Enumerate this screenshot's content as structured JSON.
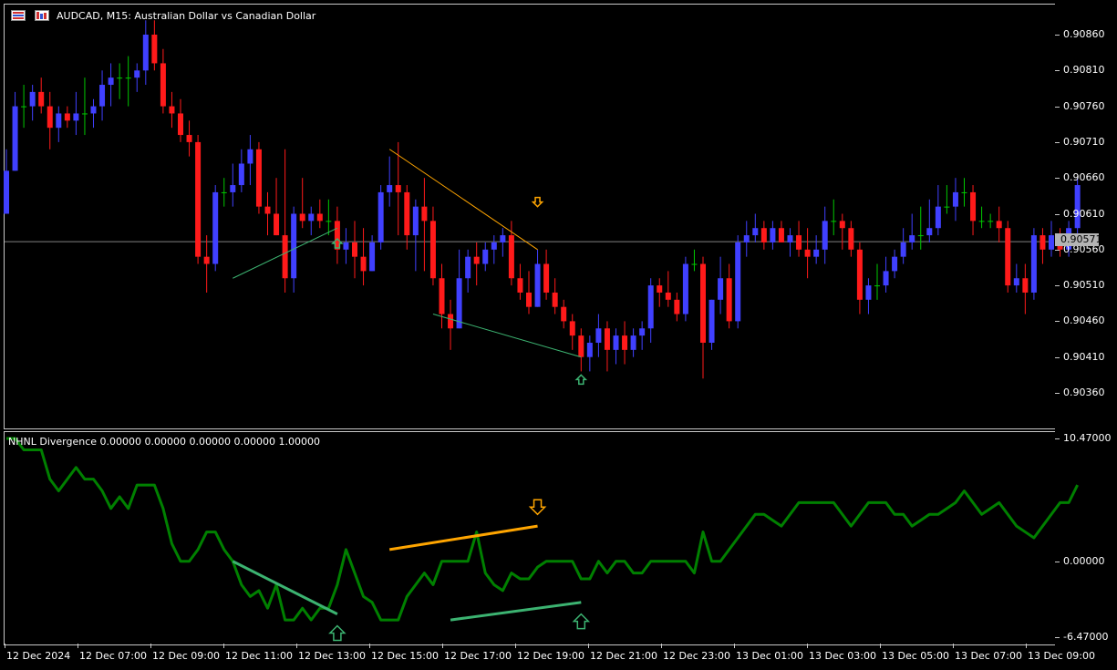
{
  "chart": {
    "symbol_title": "AUDCAD, M15:  Australian Dollar vs Canadian Dollar",
    "current_price": "0.90571",
    "price_labels": [
      "0.90860",
      "0.90810",
      "0.90760",
      "0.90710",
      "0.90660",
      "0.90610",
      "0.90560",
      "0.90510",
      "0.90460",
      "0.90410",
      "0.90360"
    ]
  },
  "indicator": {
    "title": "NHNL Divergence 0.00000 0.00000 0.00000 0.00000 1.00000",
    "labels": [
      "10.47000",
      "0.00000",
      "-6.47000"
    ]
  },
  "time_axis": {
    "labels": [
      "12 Dec 2024",
      "12 Dec 07:00",
      "12 Dec 09:00",
      "12 Dec 11:00",
      "12 Dec 13:00",
      "12 Dec 15:00",
      "12 Dec 17:00",
      "12 Dec 19:00",
      "12 Dec 21:00",
      "12 Dec 23:00",
      "13 Dec 01:00",
      "13 Dec 03:00",
      "13 Dec 05:00",
      "13 Dec 07:00",
      "13 Dec 09:00"
    ]
  },
  "colors": {
    "bull_candle": "#4040ff",
    "bear_candle": "#ff1a1a",
    "doji_candle": "#00c800",
    "indicator_line": "#008000",
    "bearish_divergence": "#ffa500",
    "bullish_divergence": "#3cb371",
    "bid_line": "#808080"
  },
  "chart_data": {
    "type": "candlestick",
    "price_range": [
      0.9032,
      0.9089
    ],
    "indicator_range": [
      -6.47,
      10.47
    ],
    "candles": [
      [
        0.9061,
        0.907,
        0.9062,
        0.9067
      ],
      [
        0.9067,
        0.9078,
        0.9067,
        0.9076
      ],
      [
        0.9076,
        0.9079,
        0.9073,
        0.9076
      ],
      [
        0.9076,
        0.9079,
        0.9074,
        0.9078
      ],
      [
        0.9078,
        0.908,
        0.9075,
        0.9076
      ],
      [
        0.9076,
        0.9078,
        0.907,
        0.9073
      ],
      [
        0.9073,
        0.9076,
        0.9071,
        0.9075
      ],
      [
        0.9075,
        0.9076,
        0.9073,
        0.9074
      ],
      [
        0.9074,
        0.9078,
        0.9072,
        0.9075
      ],
      [
        0.9075,
        0.908,
        0.9072,
        0.9075
      ],
      [
        0.9075,
        0.9077,
        0.9073,
        0.9076
      ],
      [
        0.9076,
        0.9081,
        0.9074,
        0.9079
      ],
      [
        0.9079,
        0.9082,
        0.9076,
        0.908
      ],
      [
        0.908,
        0.9082,
        0.9077,
        0.908
      ],
      [
        0.908,
        0.9083,
        0.9076,
        0.908
      ],
      [
        0.908,
        0.9082,
        0.9078,
        0.9081
      ],
      [
        0.9081,
        0.9088,
        0.9079,
        0.9086
      ],
      [
        0.9086,
        0.9088,
        0.9081,
        0.9082
      ],
      [
        0.9082,
        0.9084,
        0.9075,
        0.9076
      ],
      [
        0.9076,
        0.9078,
        0.9073,
        0.9075
      ],
      [
        0.9075,
        0.9077,
        0.9071,
        0.9072
      ],
      [
        0.9072,
        0.9074,
        0.9069,
        0.9071
      ],
      [
        0.9071,
        0.9072,
        0.9054,
        0.9055
      ],
      [
        0.9055,
        0.9058,
        0.905,
        0.9054
      ],
      [
        0.9054,
        0.9065,
        0.9053,
        0.9064
      ],
      [
        0.9064,
        0.9066,
        0.9062,
        0.9064
      ],
      [
        0.9064,
        0.9068,
        0.9062,
        0.9065
      ],
      [
        0.9065,
        0.907,
        0.9064,
        0.9068
      ],
      [
        0.9068,
        0.9072,
        0.9065,
        0.907
      ],
      [
        0.907,
        0.9071,
        0.9061,
        0.9062
      ],
      [
        0.9062,
        0.9064,
        0.9058,
        0.9061
      ],
      [
        0.9061,
        0.9066,
        0.9058,
        0.9058
      ],
      [
        0.9058,
        0.907,
        0.905,
        0.9052
      ],
      [
        0.9052,
        0.9062,
        0.905,
        0.9061
      ],
      [
        0.9061,
        0.9066,
        0.9059,
        0.906
      ],
      [
        0.906,
        0.9062,
        0.9058,
        0.9061
      ],
      [
        0.9061,
        0.9063,
        0.9059,
        0.906
      ],
      [
        0.906,
        0.9063,
        0.9058,
        0.906
      ],
      [
        0.906,
        0.9062,
        0.9054,
        0.9056
      ],
      [
        0.9056,
        0.9059,
        0.9054,
        0.9057
      ],
      [
        0.9057,
        0.906,
        0.9052,
        0.9055
      ],
      [
        0.9055,
        0.9059,
        0.9051,
        0.9053
      ],
      [
        0.9053,
        0.9058,
        0.9053,
        0.9057
      ],
      [
        0.9057,
        0.9065,
        0.9056,
        0.9064
      ],
      [
        0.9064,
        0.9069,
        0.9062,
        0.9065
      ],
      [
        0.9065,
        0.9071,
        0.9058,
        0.9064
      ],
      [
        0.9064,
        0.9065,
        0.9056,
        0.9058
      ],
      [
        0.9058,
        0.9063,
        0.9053,
        0.9062
      ],
      [
        0.9062,
        0.9066,
        0.9053,
        0.906
      ],
      [
        0.906,
        0.9062,
        0.9051,
        0.9052
      ],
      [
        0.9052,
        0.9054,
        0.9045,
        0.9047
      ],
      [
        0.9047,
        0.9049,
        0.9042,
        0.9045
      ],
      [
        0.9045,
        0.9056,
        0.9045,
        0.9052
      ],
      [
        0.9052,
        0.9056,
        0.905,
        0.9055
      ],
      [
        0.9055,
        0.9057,
        0.9051,
        0.9054
      ],
      [
        0.9054,
        0.9057,
        0.9053,
        0.9056
      ],
      [
        0.9056,
        0.9058,
        0.9054,
        0.9057
      ],
      [
        0.9057,
        0.9059,
        0.9055,
        0.9058
      ],
      [
        0.9058,
        0.906,
        0.9051,
        0.9052
      ],
      [
        0.9052,
        0.9054,
        0.9049,
        0.905
      ],
      [
        0.905,
        0.9053,
        0.9047,
        0.9048
      ],
      [
        0.9048,
        0.9056,
        0.9048,
        0.9054
      ],
      [
        0.9054,
        0.9056,
        0.9049,
        0.905
      ],
      [
        0.905,
        0.9052,
        0.9047,
        0.9048
      ],
      [
        0.9048,
        0.9049,
        0.9045,
        0.9046
      ],
      [
        0.9046,
        0.9047,
        0.9042,
        0.9044
      ],
      [
        0.9044,
        0.9045,
        0.9039,
        0.9041
      ],
      [
        0.9041,
        0.9044,
        0.9039,
        0.9043
      ],
      [
        0.9043,
        0.9047,
        0.9041,
        0.9045
      ],
      [
        0.9045,
        0.9046,
        0.9039,
        0.9042
      ],
      [
        0.9042,
        0.9045,
        0.904,
        0.9044
      ],
      [
        0.9044,
        0.9046,
        0.904,
        0.9042
      ],
      [
        0.9042,
        0.9045,
        0.9041,
        0.9044
      ],
      [
        0.9044,
        0.9046,
        0.9042,
        0.9045
      ],
      [
        0.9045,
        0.9052,
        0.9043,
        0.9051
      ],
      [
        0.9051,
        0.9052,
        0.9048,
        0.905
      ],
      [
        0.905,
        0.9053,
        0.9048,
        0.9049
      ],
      [
        0.9049,
        0.905,
        0.9046,
        0.9047
      ],
      [
        0.9047,
        0.9055,
        0.9046,
        0.9054
      ],
      [
        0.9054,
        0.9056,
        0.9053,
        0.9054
      ],
      [
        0.9054,
        0.9055,
        0.9038,
        0.9043
      ],
      [
        0.9043,
        0.9049,
        0.9042,
        0.9049
      ],
      [
        0.9049,
        0.9055,
        0.9047,
        0.9052
      ],
      [
        0.9052,
        0.9054,
        0.9045,
        0.9046
      ],
      [
        0.9046,
        0.9058,
        0.9045,
        0.9057
      ],
      [
        0.9057,
        0.906,
        0.9055,
        0.9058
      ],
      [
        0.9058,
        0.9061,
        0.9057,
        0.9059
      ],
      [
        0.9059,
        0.906,
        0.9056,
        0.9057
      ],
      [
        0.9057,
        0.906,
        0.9056,
        0.9059
      ],
      [
        0.9059,
        0.906,
        0.9057,
        0.9057
      ],
      [
        0.9057,
        0.9059,
        0.9055,
        0.9058
      ],
      [
        0.9058,
        0.906,
        0.9055,
        0.9056
      ],
      [
        0.9056,
        0.9059,
        0.9052,
        0.9055
      ],
      [
        0.9055,
        0.9058,
        0.9054,
        0.9056
      ],
      [
        0.9056,
        0.9062,
        0.9054,
        0.906
      ],
      [
        0.906,
        0.9063,
        0.9058,
        0.906
      ],
      [
        0.906,
        0.9061,
        0.9056,
        0.9059
      ],
      [
        0.9059,
        0.906,
        0.9055,
        0.9056
      ],
      [
        0.9056,
        0.9057,
        0.9047,
        0.9049
      ],
      [
        0.9049,
        0.9052,
        0.9047,
        0.9051
      ],
      [
        0.9051,
        0.9054,
        0.9049,
        0.9051
      ],
      [
        0.9051,
        0.9055,
        0.905,
        0.9053
      ],
      [
        0.9053,
        0.9056,
        0.9052,
        0.9055
      ],
      [
        0.9055,
        0.9059,
        0.9054,
        0.9057
      ],
      [
        0.9057,
        0.9061,
        0.9056,
        0.9058
      ],
      [
        0.9058,
        0.9062,
        0.9056,
        0.9058
      ],
      [
        0.9058,
        0.9063,
        0.9057,
        0.9059
      ],
      [
        0.9059,
        0.9065,
        0.9058,
        0.9062
      ],
      [
        0.9062,
        0.9065,
        0.9061,
        0.9062
      ],
      [
        0.9062,
        0.9066,
        0.906,
        0.9064
      ],
      [
        0.9064,
        0.9066,
        0.9062,
        0.9064
      ],
      [
        0.9064,
        0.9065,
        0.9058,
        0.906
      ],
      [
        0.906,
        0.9062,
        0.9059,
        0.906
      ],
      [
        0.906,
        0.9061,
        0.9059,
        0.906
      ],
      [
        0.906,
        0.9062,
        0.9057,
        0.9059
      ],
      [
        0.9059,
        0.906,
        0.905,
        0.9051
      ],
      [
        0.9051,
        0.9054,
        0.905,
        0.9052
      ],
      [
        0.9052,
        0.9054,
        0.9047,
        0.905
      ],
      [
        0.905,
        0.9059,
        0.9049,
        0.9058
      ],
      [
        0.9058,
        0.9059,
        0.9054,
        0.9056
      ],
      [
        0.9056,
        0.906,
        0.9055,
        0.9058
      ],
      [
        0.9058,
        0.9059,
        0.9055,
        0.9056
      ],
      [
        0.9056,
        0.906,
        0.9055,
        0.9059
      ],
      [
        0.9059,
        0.9066,
        0.9058,
        0.9065
      ]
    ],
    "indicator": [
      10.47,
      10.47,
      9.5,
      9.5,
      9.5,
      7,
      6,
      7,
      8,
      7,
      7,
      6,
      4.5,
      5.5,
      4.5,
      6.5,
      6.5,
      6.5,
      4.5,
      1.5,
      0,
      0,
      1,
      2.5,
      2.5,
      1,
      0,
      -2,
      -3,
      -2.5,
      -4,
      -2,
      -5,
      -5,
      -4,
      -5,
      -4,
      -4,
      -2,
      1,
      -1,
      -3,
      -3.5,
      -5,
      -5,
      -5,
      -3,
      -2,
      -1,
      -2,
      0,
      0,
      0,
      0,
      2.5,
      -1,
      -2,
      -2.5,
      -1,
      -1.5,
      -1.5,
      -0.5,
      0,
      0,
      0,
      0,
      -1.5,
      -1.5,
      0,
      -1,
      0,
      0,
      -1,
      -1,
      0,
      0,
      0,
      0,
      0,
      -1,
      2.5,
      0,
      0,
      1,
      2,
      3,
      4,
      4,
      3.5,
      3,
      4,
      5,
      5,
      5,
      5,
      5,
      4,
      3,
      4,
      5,
      5,
      5,
      4,
      4,
      3,
      3.5,
      4,
      4,
      4.5,
      5,
      6,
      5,
      4,
      4.5,
      5,
      4,
      3,
      2.5,
      2,
      3,
      4,
      5,
      5,
      6.5
    ],
    "bid_price": 0.90571,
    "divergence_lines": [
      {
        "pane": "main",
        "from": [
          26,
          0.9052
        ],
        "to": [
          38,
          0.9059
        ],
        "kind": "bullish"
      },
      {
        "pane": "main",
        "from": [
          49,
          0.9047
        ],
        "to": [
          66,
          0.9041
        ],
        "kind": "bullish"
      },
      {
        "pane": "main",
        "from": [
          44,
          0.907
        ],
        "to": [
          61,
          0.9056
        ],
        "kind": "bearish"
      },
      {
        "pane": "indicator",
        "from": [
          26,
          0
        ],
        "to": [
          38,
          -4.5
        ],
        "kind": "bullish"
      },
      {
        "pane": "indicator",
        "from": [
          51,
          -5
        ],
        "to": [
          66,
          -3.5
        ],
        "kind": "bullish"
      },
      {
        "pane": "indicator",
        "from": [
          44,
          1
        ],
        "to": [
          61,
          3.0
        ],
        "kind": "bearish"
      }
    ],
    "arrows": [
      {
        "pane": "main",
        "index": 38,
        "price": 0.90575,
        "dir": "up",
        "kind": "bullish"
      },
      {
        "pane": "main",
        "index": 66,
        "price": 0.90385,
        "dir": "up",
        "kind": "bullish"
      },
      {
        "pane": "main",
        "index": 61,
        "price": 0.9062,
        "dir": "down",
        "kind": "bearish"
      },
      {
        "pane": "indicator",
        "index": 38,
        "value": -5.5,
        "dir": "up",
        "kind": "bullish"
      },
      {
        "pane": "indicator",
        "index": 66,
        "value": -4.5,
        "dir": "up",
        "kind": "bullish"
      },
      {
        "pane": "indicator",
        "index": 61,
        "value": 4.0,
        "dir": "down",
        "kind": "bearish"
      }
    ]
  }
}
